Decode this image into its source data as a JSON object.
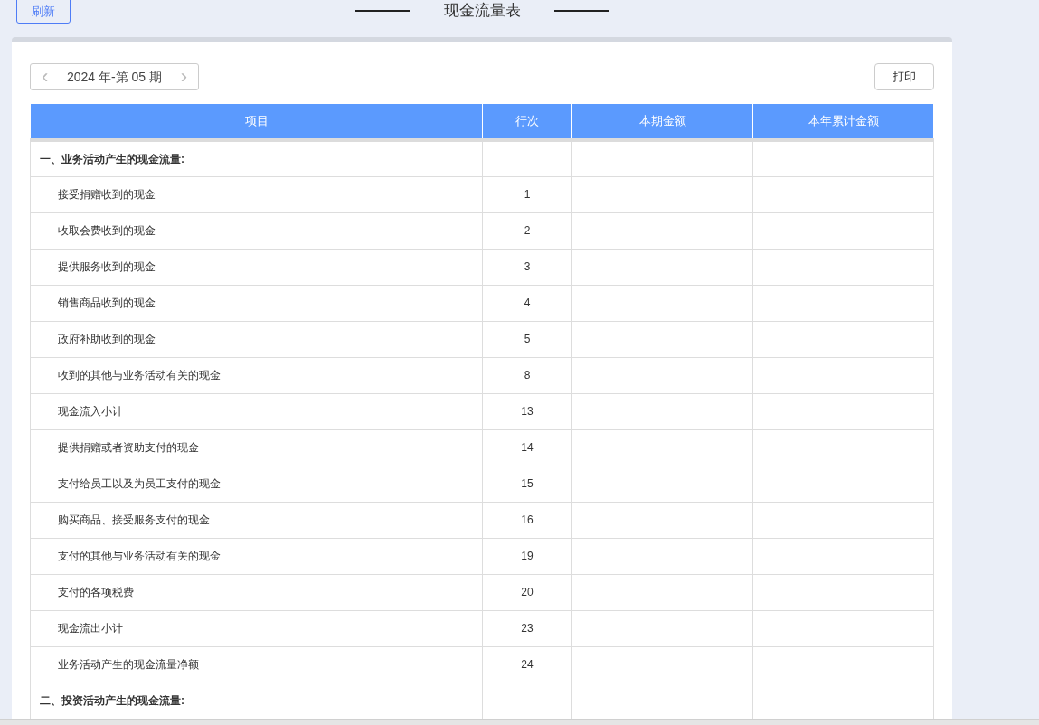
{
  "refresh_button": "刷新",
  "title": "现金流量表",
  "period_picker": {
    "prev": "‹",
    "value": "2024 年-第 05 期",
    "next": "›"
  },
  "print_button": "打印",
  "table": {
    "columns": [
      "项目",
      "行次",
      "本期金额",
      "本年累计金额"
    ],
    "rows": [
      {
        "kind": "section",
        "item": "一、业务活动产生的现金流量:"
      },
      {
        "kind": "item",
        "item": "接受捐赠收到的现金",
        "line": "1"
      },
      {
        "kind": "item",
        "item": "收取会费收到的现金",
        "line": "2"
      },
      {
        "kind": "item",
        "item": "提供服务收到的现金",
        "line": "3"
      },
      {
        "kind": "item",
        "item": "销售商品收到的现金",
        "line": "4"
      },
      {
        "kind": "item",
        "item": "政府补助收到的现金",
        "line": "5"
      },
      {
        "kind": "item",
        "item": "收到的其他与业务活动有关的现金",
        "line": "8"
      },
      {
        "kind": "item",
        "item": "现金流入小计",
        "line": "13"
      },
      {
        "kind": "item",
        "item": "提供捐赠或者资助支付的现金",
        "line": "14"
      },
      {
        "kind": "item",
        "item": "支付给员工以及为员工支付的现金",
        "line": "15"
      },
      {
        "kind": "item",
        "item": "购买商品、接受服务支付的现金",
        "line": "16"
      },
      {
        "kind": "item",
        "item": "支付的其他与业务活动有关的现金",
        "line": "19"
      },
      {
        "kind": "item",
        "item": "支付的各项税费",
        "line": "20"
      },
      {
        "kind": "item",
        "item": "现金流出小计",
        "line": "23"
      },
      {
        "kind": "item",
        "item": "业务活动产生的现金流量净额",
        "line": "24"
      },
      {
        "kind": "section",
        "item": "二、投资活动产生的现金流量:"
      }
    ]
  }
}
